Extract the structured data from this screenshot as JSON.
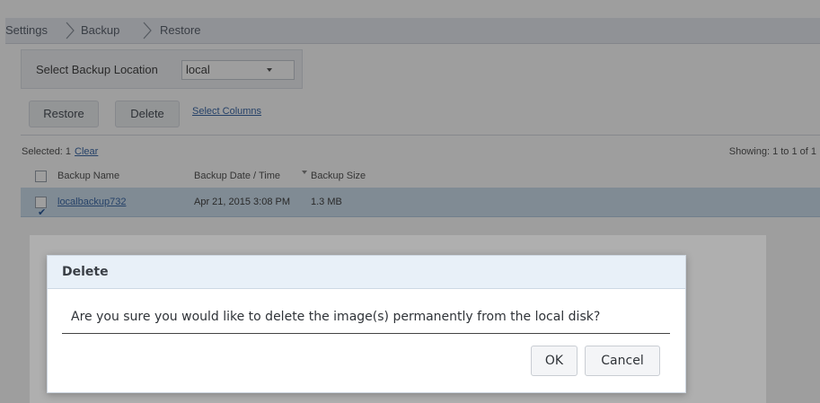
{
  "breadcrumb": {
    "items": [
      "Settings",
      "Backup",
      "Restore"
    ]
  },
  "location": {
    "label": "Select Backup Location",
    "selected": "local"
  },
  "toolbar": {
    "restore_label": "Restore",
    "delete_label": "Delete",
    "select_columns_label": "Select Columns"
  },
  "selection": {
    "selected_text": "Selected: 1",
    "clear_label": "Clear",
    "showing_text": "Showing: 1 to 1 of 1"
  },
  "table": {
    "columns": [
      "Backup Name",
      "Backup Date / Time",
      "Backup Size"
    ],
    "rows": [
      {
        "name": "localbackup732",
        "date": "Apr 21, 2015 3:08 PM",
        "size": "1.3 MB",
        "checked": true
      }
    ]
  },
  "dialog": {
    "title": "Delete",
    "message": "Are you sure you would like to delete the image(s) permanently from the local disk?",
    "ok_label": "OK",
    "cancel_label": "Cancel"
  },
  "colors": {
    "overlay": "#000000",
    "link": "#3d6aa8",
    "selected_row": "#cfe0ef",
    "dialog_header": "#e8f0f8"
  },
  "icons": {
    "breadcrumb_separator": "chevron-right-icon",
    "dropdown": "caret-down-icon",
    "sort": "sort-down-icon",
    "row_check": "checkbox-checked-icon"
  }
}
